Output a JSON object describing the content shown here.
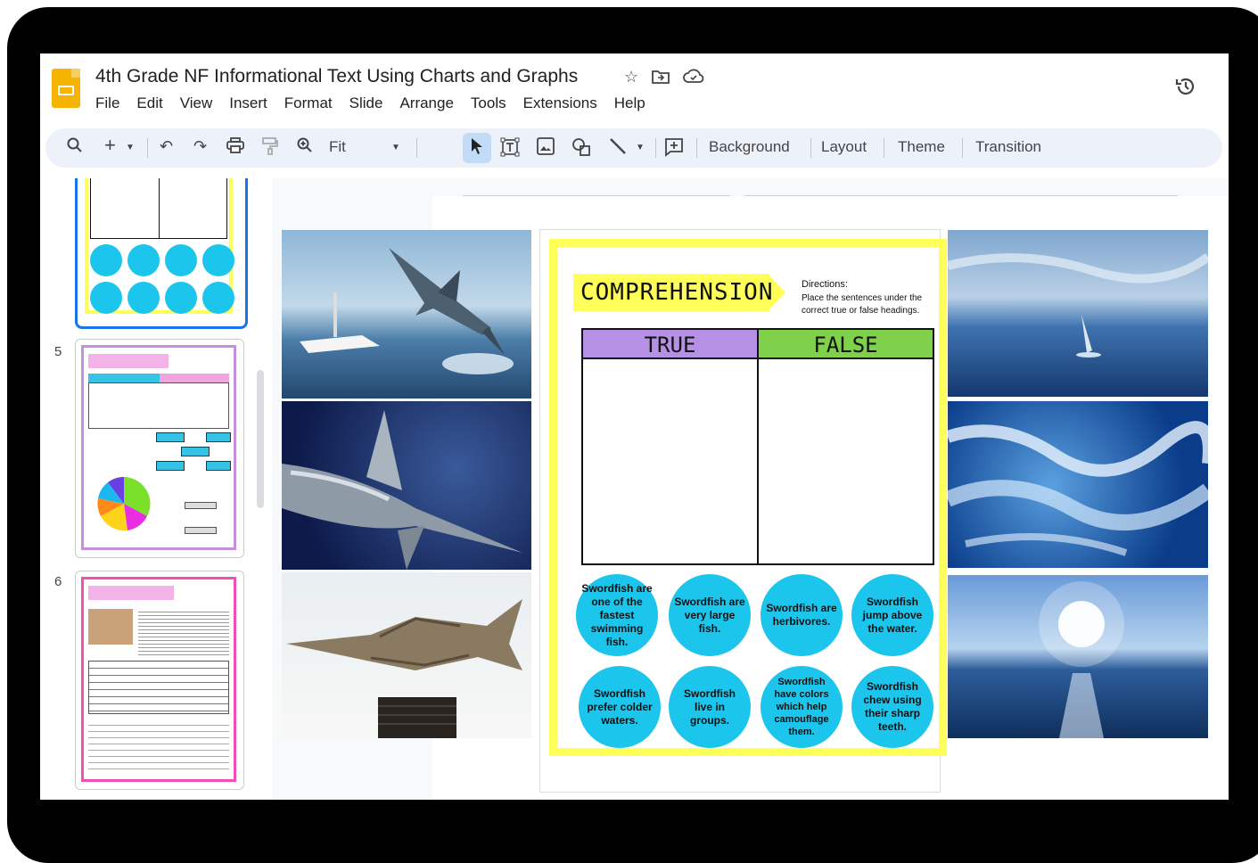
{
  "app": {
    "doc_title": "4th Grade NF Informational Text Using Charts and Graphs",
    "menu": [
      "File",
      "Edit",
      "View",
      "Insert",
      "Format",
      "Slide",
      "Arrange",
      "Tools",
      "Extensions",
      "Help"
    ]
  },
  "toolbar": {
    "zoom_label": "Fit",
    "background_label": "Background",
    "layout_label": "Layout",
    "theme_label": "Theme",
    "transition_label": "Transition"
  },
  "filmstrip": {
    "slide_numbers": [
      "5",
      "6"
    ]
  },
  "slide": {
    "banner": "COMPREHENSION",
    "directions_title": "Directions:",
    "directions_body": "Place the sentences under the correct true or false headings.",
    "true_label": "TRUE",
    "false_label": "FALSE",
    "sentences": [
      "Swordfish are one of the fastest swimming fish.",
      "Swordfish are very large fish.",
      "Swordfish are herbivores.",
      "Swordfish jump above the water.",
      "Swordfish prefer colder waters.",
      "Swordfish live in groups.",
      "Swordfish have colors which help camouflage them.",
      "Swordfish chew using their sharp teeth."
    ]
  },
  "colors": {
    "accent_yellow": "#ffff5a",
    "true_purple": "#b690e4",
    "false_green": "#7fd14b",
    "circle_blue": "#1cc5ec",
    "slides_logo": "#f4b400"
  }
}
